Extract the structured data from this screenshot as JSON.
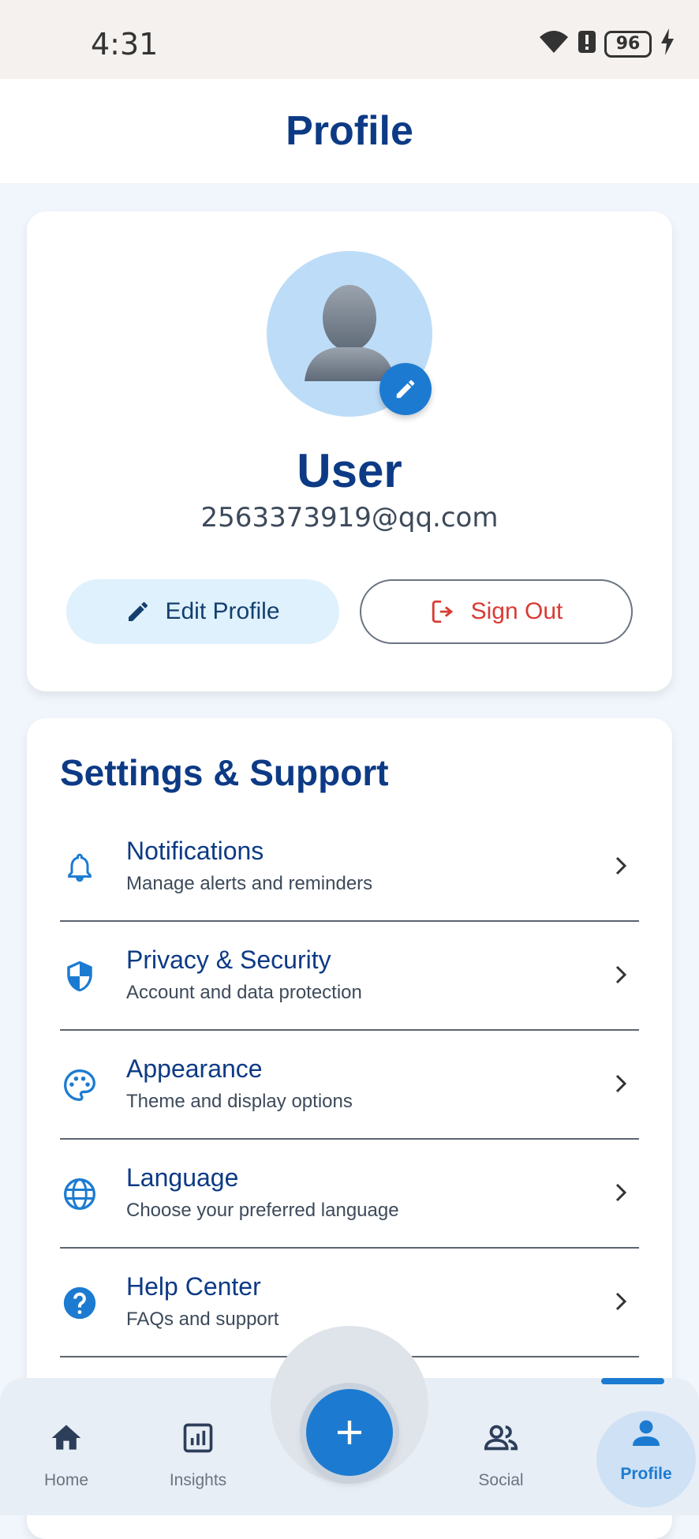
{
  "status_bar": {
    "time": "4:31",
    "battery": "96"
  },
  "header": {
    "title": "Profile"
  },
  "profile": {
    "name": "User",
    "email": "2563373919@qq.com",
    "edit_label": "Edit Profile",
    "signout_label": "Sign Out"
  },
  "settings": {
    "title": "Settings & Support",
    "items": [
      {
        "title": "Notifications",
        "subtitle": "Manage alerts and reminders",
        "icon": "bell-icon"
      },
      {
        "title": "Privacy & Security",
        "subtitle": "Account and data protection",
        "icon": "shield-icon"
      },
      {
        "title": "Appearance",
        "subtitle": "Theme and display options",
        "icon": "palette-icon"
      },
      {
        "title": "Language",
        "subtitle": "Choose your preferred language",
        "icon": "globe-icon"
      },
      {
        "title": "Help Center",
        "subtitle": "FAQs and support",
        "icon": "help-icon"
      }
    ]
  },
  "nav": {
    "home": "Home",
    "insights": "Insights",
    "social": "Social",
    "profile": "Profile"
  },
  "colors": {
    "primary": "#1c7bd1",
    "title": "#0d3a85",
    "danger": "#d93b33"
  }
}
